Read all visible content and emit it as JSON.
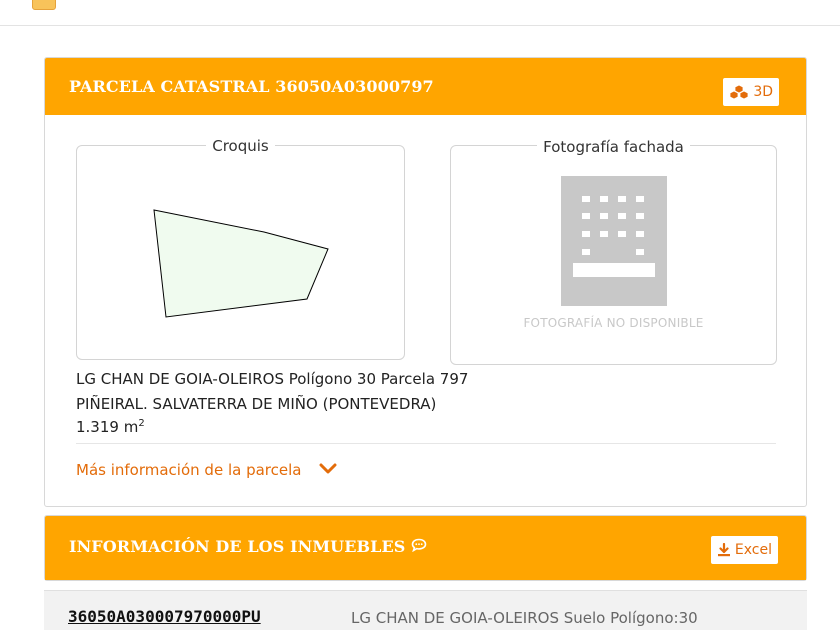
{
  "colors": {
    "accent": "#ffa500",
    "link": "#e36c0a",
    "parcel_fill": "#f0fbef"
  },
  "parcel_panel": {
    "title": "PARCELA CATASTRAL 36050A03000797",
    "btn_3d": {
      "icon": "cubes-icon",
      "label": "3D"
    },
    "sketch_label": "Croquis",
    "photo_label": "Fotografía fachada",
    "photo_icon": "building-icon",
    "no_photo_text": "FOTOGRAFÍA NO DISPONIBLE",
    "address_line1": "LG CHAN DE GOIA-OLEIROS Polígono 30 Parcela 797",
    "address_line2": "PIÑEIRAL. SALVATERRA DE MIÑO (PONTEVEDRA)",
    "area_value": "1.319 m",
    "area_unit_sup": "2",
    "more_info": {
      "label": "Más información de la parcela",
      "icon": "chevron-down-icon"
    }
  },
  "inmuebles_panel": {
    "title": "INFORMACIÓN DE LOS INMUEBLES",
    "title_icon": "comment-icon",
    "btn_excel": {
      "icon": "download-icon",
      "label": "Excel"
    },
    "rows": [
      {
        "ref": "36050A030007970000PU",
        "desc": "LG CHAN DE GOIA-OLEIROS Suelo Polígono:30"
      }
    ]
  }
}
